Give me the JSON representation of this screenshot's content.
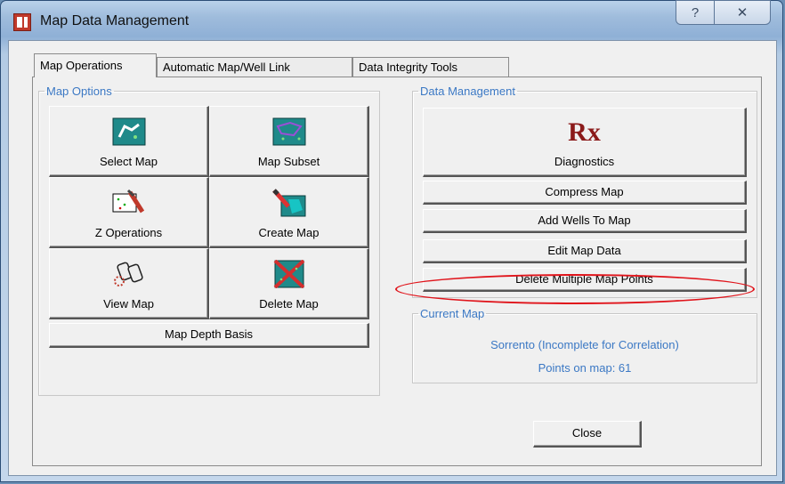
{
  "window": {
    "title": "Map Data Management",
    "help_glyph": "?",
    "close_glyph": "✕"
  },
  "tabs": [
    "Map Operations",
    "Automatic Map/Well Link",
    "Data Integrity Tools"
  ],
  "map_options": {
    "legend": "Map Options",
    "buttons": {
      "select_map": "Select Map",
      "map_subset": "Map Subset",
      "z_operations": "Z Operations",
      "create_map": "Create Map",
      "view_map": "View Map",
      "delete_map": "Delete Map",
      "map_depth_basis": "Map Depth Basis"
    },
    "icons": [
      "select-map-icon",
      "map-subset-icon",
      "z-operations-icon",
      "create-map-icon",
      "binoculars-icon",
      "delete-map-icon"
    ]
  },
  "data_management": {
    "legend": "Data Management",
    "diagnostics_symbol": "Rx",
    "buttons": {
      "diagnostics": "Diagnostics",
      "compress_map": "Compress Map",
      "add_wells": "Add Wells To Map",
      "edit_map_data": "Edit Map Data",
      "delete_multiple": "Delete Multiple Map Points"
    }
  },
  "current_map": {
    "legend": "Current Map",
    "name": "Sorrento (Incomplete for Correlation)",
    "points": "Points on map: 61"
  },
  "footer": {
    "close_label": "Close"
  },
  "colors": {
    "group_label": "#3b78c4",
    "highlight": "#e0141b",
    "rx": "#8b1a1a"
  }
}
